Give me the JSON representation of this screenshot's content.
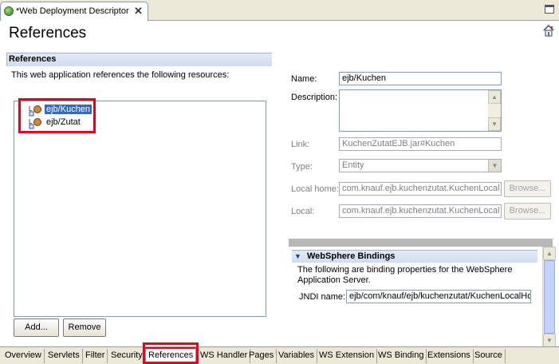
{
  "editor": {
    "tab_title": "*Web Deployment Descriptor",
    "close_glyph": "✕"
  },
  "page": {
    "title": "References",
    "help_icon": "house-help-icon"
  },
  "references_section": {
    "header": "References",
    "description": "This web application references the following resources:",
    "items": [
      {
        "label": "ejb/Kuchen",
        "selected": true
      },
      {
        "label": "ejb/Zutat",
        "selected": false
      }
    ],
    "add_label": "Add...",
    "remove_label": "Remove"
  },
  "details": {
    "name_label": "Name:",
    "name_value": "ejb/Kuchen",
    "description_label": "Description:",
    "link_label": "Link:",
    "link_value": "KuchenZutatEJB.jar#Kuchen",
    "type_label": "Type:",
    "type_value": "Entity",
    "local_home_label": "Local home:",
    "local_home_value": "com.knauf.ejb.kuchenzutat.KuchenLocal",
    "local_label": "Local:",
    "local_value": "com.knauf.ejb.kuchenzutat.KuchenLocal",
    "browse_label": "Browse..."
  },
  "websphere": {
    "title": "WebSphere Bindings",
    "description": "The following are binding properties for the WebSphere Application Server.",
    "jndi_label": "JNDI name:",
    "jndi_value": "ejb/com/knauf/ejb/kuchenzutat/KuchenLocalHo"
  },
  "bottom_tabs": [
    {
      "label": "Overview",
      "active": false
    },
    {
      "label": "Servlets",
      "active": false
    },
    {
      "label": "Filter",
      "active": false
    },
    {
      "label": "Security",
      "active": false
    },
    {
      "label": "References",
      "active": true
    },
    {
      "label": "WS Handler",
      "active": false
    },
    {
      "label": "Pages",
      "active": false
    },
    {
      "label": "Variables",
      "active": false
    },
    {
      "label": "WS Extension",
      "active": false
    },
    {
      "label": "WS Binding",
      "active": false
    },
    {
      "label": "Extensions",
      "active": false
    },
    {
      "label": "Source",
      "active": false
    }
  ],
  "colors": {
    "annotation_red": "#e8001c",
    "selection_blue": "#316ac5",
    "section_blue": "#cfdcef"
  }
}
